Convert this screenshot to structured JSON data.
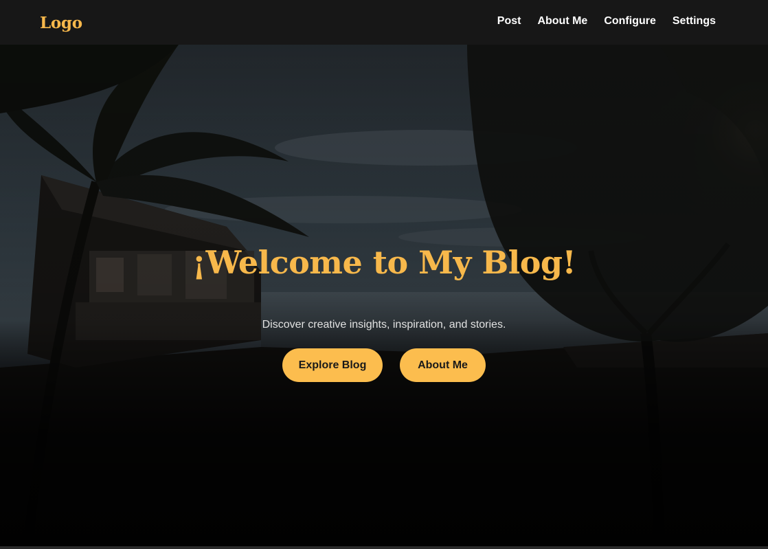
{
  "brand": {
    "logo_text": "Logo",
    "accent_color": "#f7b84b"
  },
  "nav": {
    "items": [
      {
        "label": "Post"
      },
      {
        "label": "About Me"
      },
      {
        "label": "Configure"
      },
      {
        "label": "Settings"
      }
    ]
  },
  "hero": {
    "title": "¡Welcome to My Blog!",
    "subtitle": "Discover creative insights, inspiration, and stories.",
    "buttons": [
      {
        "label": "Explore Blog"
      },
      {
        "label": "About Me"
      }
    ],
    "button_color": "#fcbd4e",
    "background_image": "dusk-beach-house-palm-trees"
  }
}
